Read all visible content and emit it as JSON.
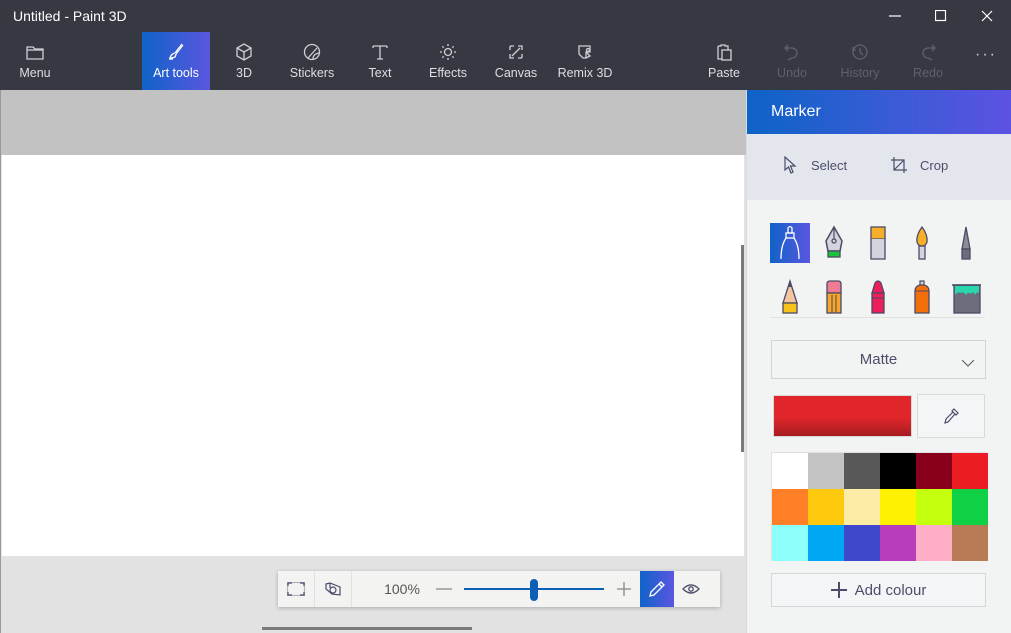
{
  "window": {
    "title": "Untitled - Paint 3D",
    "controls": [
      "minimize",
      "maximize",
      "close"
    ]
  },
  "toolbar": {
    "items": [
      {
        "label": "Menu",
        "icon": "folder-icon",
        "state": "normal"
      },
      {
        "label": "Art tools",
        "icon": "brush-icon",
        "state": "active"
      },
      {
        "label": "3D",
        "icon": "cube-icon",
        "state": "normal"
      },
      {
        "label": "Stickers",
        "icon": "sticker-icon",
        "state": "normal"
      },
      {
        "label": "Text",
        "icon": "text-icon",
        "state": "normal"
      },
      {
        "label": "Effects",
        "icon": "sun-icon",
        "state": "normal"
      },
      {
        "label": "Canvas",
        "icon": "resize-icon",
        "state": "normal"
      },
      {
        "label": "Remix 3D",
        "icon": "remix-icon",
        "state": "normal"
      },
      {
        "label": "Paste",
        "icon": "clipboard-icon",
        "state": "normal"
      },
      {
        "label": "Undo",
        "icon": "undo-icon",
        "state": "disabled"
      },
      {
        "label": "History",
        "icon": "history-icon",
        "state": "disabled"
      },
      {
        "label": "Redo",
        "icon": "redo-icon",
        "state": "disabled"
      }
    ],
    "more_label": "···"
  },
  "zoombar": {
    "zoom_percent_label": "100%",
    "zoom_slider_fraction": 0.5,
    "accent_color": "#0c5fb7"
  },
  "panel": {
    "title": "Marker",
    "select_label": "Select",
    "crop_label": "Crop",
    "brushes": [
      {
        "name": "marker",
        "selected": true
      },
      {
        "name": "calligraphy-pen",
        "selected": false
      },
      {
        "name": "oil-brush",
        "selected": false
      },
      {
        "name": "watercolor",
        "selected": false
      },
      {
        "name": "pixel-pen",
        "selected": false
      },
      {
        "name": "pencil",
        "selected": false
      },
      {
        "name": "eraser",
        "selected": false
      },
      {
        "name": "crayon",
        "selected": false
      },
      {
        "name": "spray-can",
        "selected": false
      },
      {
        "name": "fill",
        "selected": false
      }
    ],
    "finish_dropdown": {
      "selected": "Matte"
    },
    "current_color": "#e0262b",
    "palette": [
      "#ffffff",
      "#c3c3c3",
      "#585858",
      "#000000",
      "#88001b",
      "#ec1c24",
      "#ff7f27",
      "#ffc90e",
      "#fdeca6",
      "#fff200",
      "#c4ff0e",
      "#0ed145",
      "#8cfffb",
      "#00a8f3",
      "#3f48cc",
      "#b83dba",
      "#ffaec8",
      "#b97a56"
    ],
    "add_color_label": "Add colour"
  },
  "theme": {
    "chrome_bg": "#363842",
    "accent_gradient_start": "#0f63c8",
    "accent_gradient_end": "#5b56e0"
  }
}
